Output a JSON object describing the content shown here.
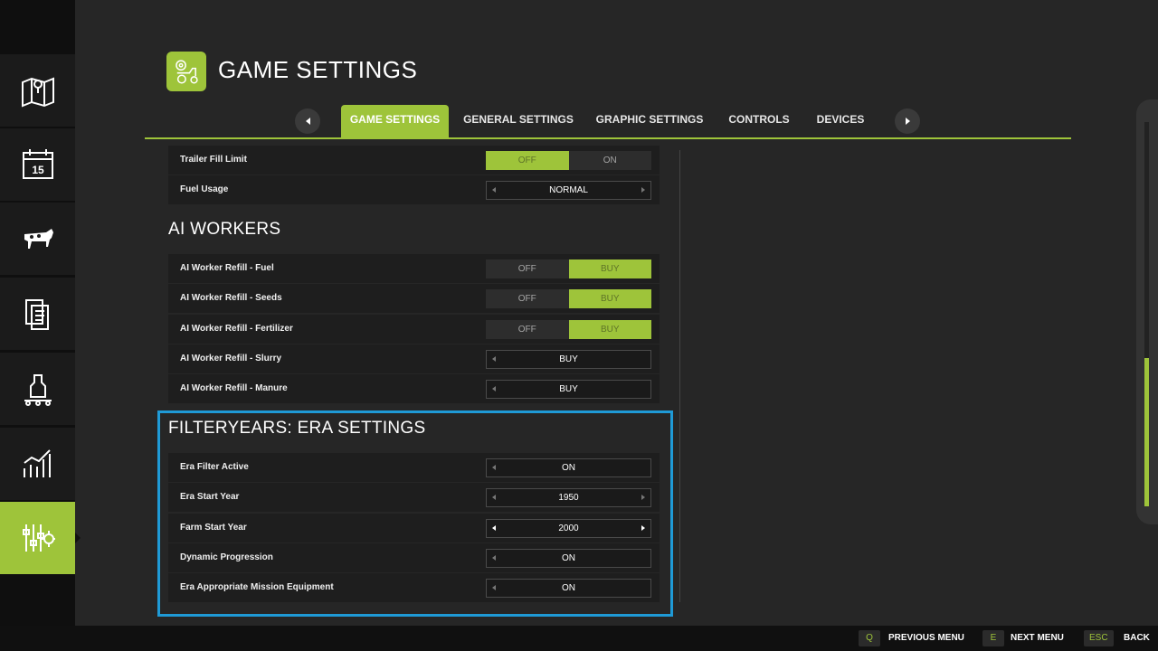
{
  "page_title": "GAME SETTINGS",
  "tabs": [
    {
      "label": "GAME SETTINGS",
      "active": true
    },
    {
      "label": "GENERAL SETTINGS",
      "active": false
    },
    {
      "label": "GRAPHIC SETTINGS",
      "active": false
    },
    {
      "label": "CONTROLS",
      "active": false
    },
    {
      "label": "DEVICES",
      "active": false
    }
  ],
  "sidebar": {
    "items": [
      {
        "icon": "map-icon"
      },
      {
        "icon": "calendar-icon",
        "text": "15"
      },
      {
        "icon": "cow-icon"
      },
      {
        "icon": "contracts-icon"
      },
      {
        "icon": "production-icon"
      },
      {
        "icon": "statistics-icon"
      },
      {
        "icon": "settings-icon",
        "active": true
      }
    ]
  },
  "settings_top": {
    "trailer_fill_limit": {
      "label": "Trailer Fill Limit",
      "options": [
        "OFF",
        "ON"
      ],
      "selected": "OFF"
    },
    "fuel_usage": {
      "label": "Fuel Usage",
      "value": "NORMAL"
    }
  },
  "ai_workers": {
    "title": "AI WORKERS",
    "refill_fuel": {
      "label": "AI Worker Refill - Fuel",
      "options": [
        "OFF",
        "BUY"
      ],
      "selected": "BUY"
    },
    "refill_seeds": {
      "label": "AI Worker Refill - Seeds",
      "options": [
        "OFF",
        "BUY"
      ],
      "selected": "BUY"
    },
    "refill_fertilizer": {
      "label": "AI Worker Refill - Fertilizer",
      "options": [
        "OFF",
        "BUY"
      ],
      "selected": "BUY"
    },
    "refill_slurry": {
      "label": "AI Worker Refill - Slurry",
      "value": "BUY"
    },
    "refill_manure": {
      "label": "AI Worker Refill - Manure",
      "value": "BUY"
    }
  },
  "era_settings": {
    "title": "FILTERYEARS: ERA SETTINGS",
    "era_filter_active": {
      "label": "Era Filter Active",
      "value": "ON"
    },
    "era_start_year": {
      "label": "Era Start Year",
      "value": "1950"
    },
    "farm_start_year": {
      "label": "Farm Start Year",
      "value": "2000"
    },
    "dynamic_progression": {
      "label": "Dynamic Progression",
      "value": "ON"
    },
    "mission_equipment": {
      "label": "Era Appropriate Mission Equipment",
      "value": "ON"
    }
  },
  "footer": {
    "prev_key": "Q",
    "prev_label": "PREVIOUS MENU",
    "next_key": "E",
    "next_label": "NEXT MENU",
    "back_key": "ESC",
    "back_label": "BACK"
  },
  "colors": {
    "accent": "#9ec43a",
    "highlight": "#1f9ad6",
    "background": "#262626"
  }
}
